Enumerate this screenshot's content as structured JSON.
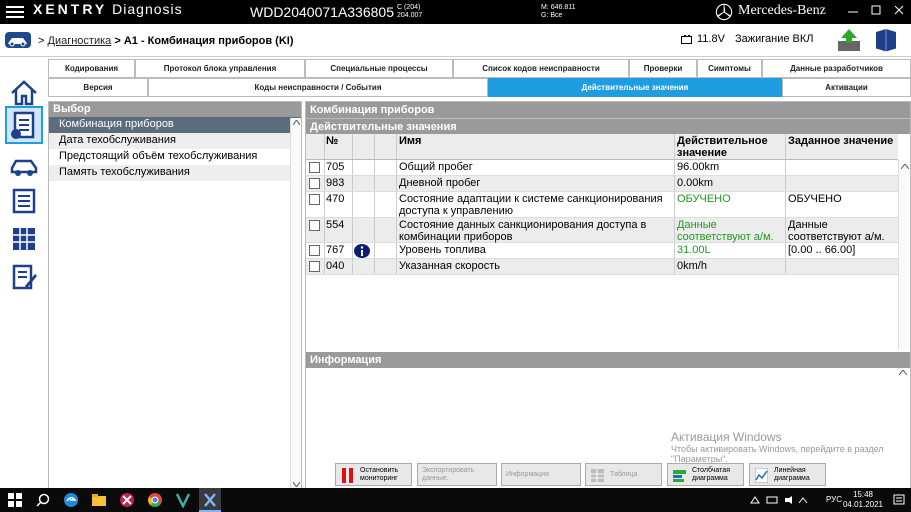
{
  "app": {
    "brand_strong": "XENTRY",
    "brand_light": "Diagnosis",
    "vin": "WDD2040071A336805",
    "model_line1": "C (204)",
    "model_line2": "204.007",
    "mver_line1": "M: 646.811",
    "mver_line2": "G: Все",
    "maker": "Mercedes-Benz"
  },
  "header": {
    "crumb_root": "Диагностика",
    "crumb_sep": ">",
    "crumb_current": "A1 - Комбинация приборов (KI)",
    "voltage": "11.8V",
    "ignition": "Зажигание ВКЛ"
  },
  "tabs_row1": [
    "Кодирования",
    "Протокол блока управления",
    "Специальные процессы",
    "Список кодов неисправности",
    "Проверки",
    "Симптомы",
    "Данные разработчиков"
  ],
  "tabs_row2": [
    "Версия",
    "Коды неисправности / События",
    "Действительные значения",
    "Активации"
  ],
  "selection": {
    "title": "Выбор",
    "items": [
      "Комбинация приборов",
      "Дата техобслуживания",
      "Предстоящий объём техобслуживания",
      "Память техобслуживания"
    ]
  },
  "main": {
    "title": "Комбинация приборов",
    "subtitle": "Действительные значения",
    "columns": {
      "num": "№",
      "name": "Имя",
      "actual": "Действительное значение",
      "target": "Заданное значение"
    },
    "rows": [
      {
        "num": "705",
        "name": "Общий пробег",
        "actual": "96.00km",
        "target": ""
      },
      {
        "num": "983",
        "name": "Дневной пробег",
        "actual": "0.00km",
        "target": ""
      },
      {
        "num": "470",
        "name": "Состояние адаптации к системе санкционирования доступа к управлению",
        "actual": "ОБУЧЕНО",
        "target": "ОБУЧЕНО"
      },
      {
        "num": "554",
        "name": "Состояние данных санкционирования доступа в комбинации приборов",
        "actual": "Данные соответствуют а/м.",
        "target": "Данные соответствуют а/м."
      },
      {
        "num": "767",
        "name": "Уровень топлива",
        "actual": "31.00L",
        "target": "[0.00 .. 66.00]"
      },
      {
        "num": "040",
        "name": "Указанная скорость",
        "actual": "0km/h",
        "target": ""
      }
    ],
    "info_title": "Информация"
  },
  "watermark": {
    "line1": "Активация Windows",
    "line2": "Чтобы активировать Windows, перейдите в раздел \"Параметры\"."
  },
  "buttons": [
    {
      "l1": "Остановить",
      "l2": "мониторинг"
    },
    {
      "l1": "Экспортировать",
      "l2": "данные."
    },
    {
      "l1": "Информация",
      "l2": ""
    },
    {
      "l1": "Таблица",
      "l2": ""
    },
    {
      "l1": "Столбчатая",
      "l2": "диаграмма"
    },
    {
      "l1": "Линейная",
      "l2": "диаграмма"
    }
  ],
  "taskbar": {
    "lang": "РУС",
    "time": "15:48",
    "date": "04.01.2021"
  },
  "colors": {
    "accent": "#1e9de1",
    "selected_row": "#5c6b7e",
    "green_value": "#1e9a1e"
  }
}
